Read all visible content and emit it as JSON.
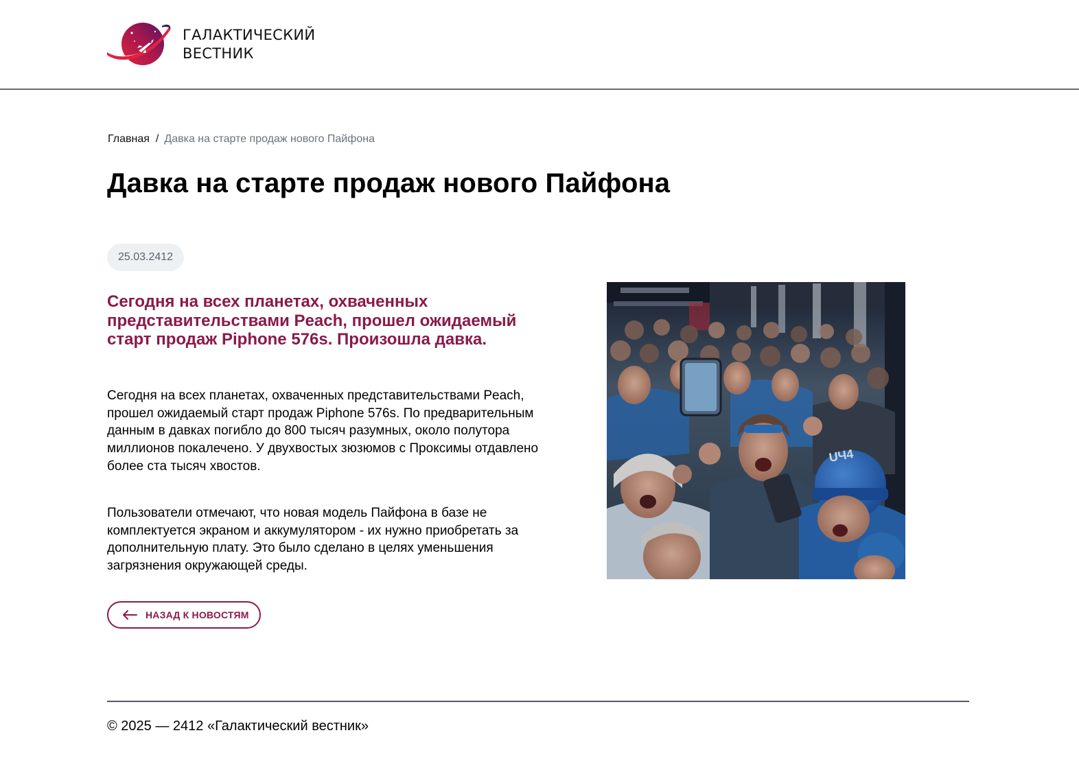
{
  "header": {
    "brand_line1": "ГАЛАКТИЧЕСКИЙ",
    "brand_line2": "ВЕСТНИК"
  },
  "breadcrumb": {
    "home": "Главная",
    "separator": "/",
    "current": "Давка на старте продаж нового Пайфона"
  },
  "article": {
    "title": "Давка на старте продаж нового Пайфона",
    "date": "25.03.2412",
    "lead": "Сегодня на всех планетах, охваченных представительствами Peach, прошел ожидаемый старт продаж Piphone 576s. Произошла давка.",
    "paragraph1": "Сегодня на всех планетах, охваченных представительствами Peach, прошел ожидаемый старт продаж Piphone 576s. По предварительным данным в давках погибло до 800 тысяч разумных, около полутора миллионов покалечено. У двухвостых зюзюмов с Проксимы отдавлено более ста тысяч хвостов.",
    "paragraph2": "Пользователи отмечают, что новая модель Пайфона в базе не комплектуется экраном и аккумулятором - их нужно приобретать за дополнительную плату. Это было сделано в целях уменьшения загрязнения окружающей среды.",
    "back_label": "НАЗАД К НОВОСТЯМ",
    "image_icon": "crowd-photo"
  },
  "footer": {
    "copyright": "© 2025 — 2412 «Галактический вестник»"
  },
  "colors": {
    "accent": "#8a1a4a",
    "badge_bg": "#eef1f4",
    "header_border": "#6b6b6b",
    "footer_line": "#55596c"
  }
}
